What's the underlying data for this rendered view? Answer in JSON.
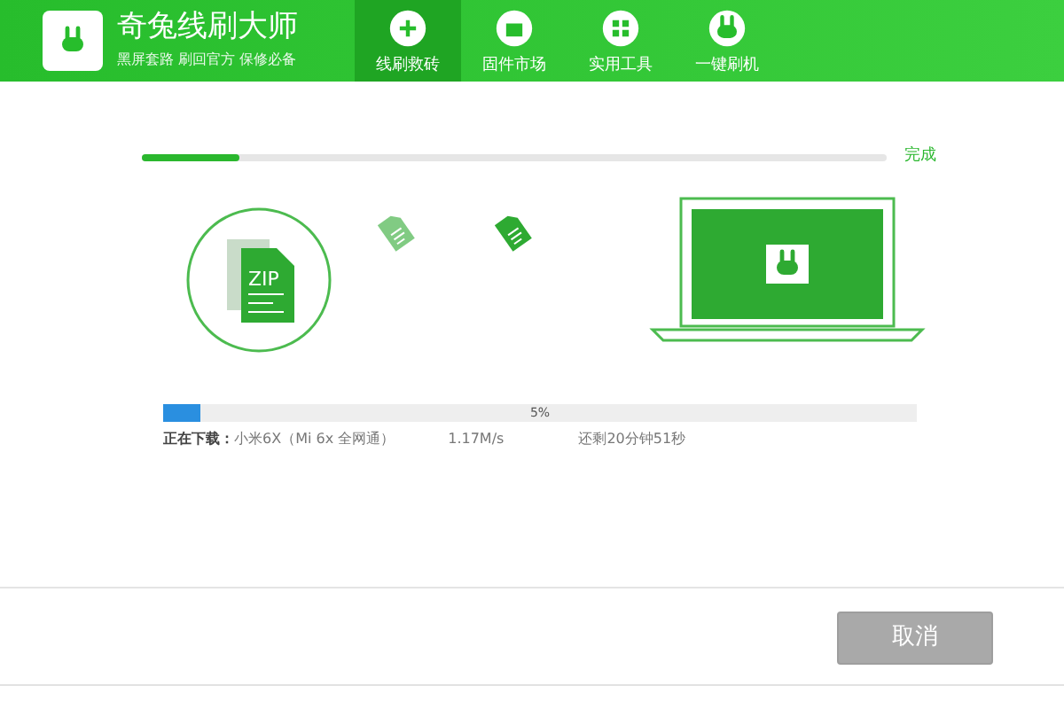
{
  "app": {
    "title": "奇兔线刷大师",
    "slogan": "黑屏套路 刷回官方 保修必备"
  },
  "tabs": [
    {
      "label": "线刷救砖",
      "selected": true
    },
    {
      "label": "固件市场",
      "selected": false
    },
    {
      "label": "实用工具",
      "selected": false
    },
    {
      "label": "一键刷机",
      "selected": false
    }
  ],
  "zip_label": "ZIP",
  "steps": {
    "level": 0.13,
    "end_label": "完成"
  },
  "download": {
    "level": 0.05,
    "percent": "5%",
    "label": "正在下载：",
    "device": "小米6X（Mi 6x 全网通）",
    "speed": "1.17M/s",
    "remaining": "还剩20分钟51秒"
  },
  "cancel_button": {
    "label": "取消",
    "disabled": true
  }
}
